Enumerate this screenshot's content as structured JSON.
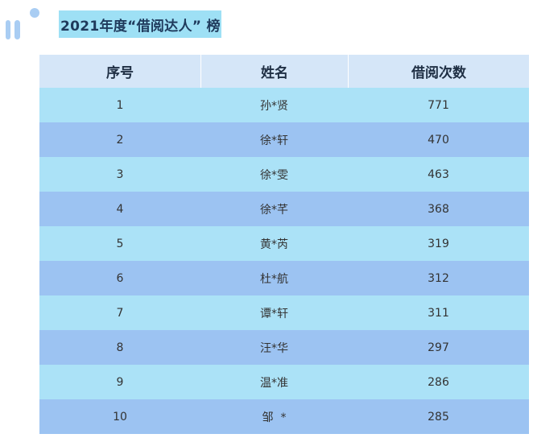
{
  "title": "2021年度“借阅达人” 榜",
  "colors": {
    "title_bg": "#9ee0f5",
    "header_bg": "#d5e6f8",
    "row_light": "#abe2f7",
    "row_dark": "#9cc3f2",
    "decoration": "#a9cdf3"
  },
  "table": {
    "headers": [
      "序号",
      "姓名",
      "借阅次数"
    ],
    "rows": [
      {
        "rank": "1",
        "name": "孙*贤",
        "count": "771"
      },
      {
        "rank": "2",
        "name": "徐*轩",
        "count": "470"
      },
      {
        "rank": "3",
        "name": "徐*雯",
        "count": "463"
      },
      {
        "rank": "4",
        "name": "徐*芊",
        "count": "368"
      },
      {
        "rank": "5",
        "name": "黄*芮",
        "count": "319"
      },
      {
        "rank": "6",
        "name": "杜*航",
        "count": "312"
      },
      {
        "rank": "7",
        "name": "谭*轩",
        "count": "311"
      },
      {
        "rank": "8",
        "name": "汪*华",
        "count": "297"
      },
      {
        "rank": "9",
        "name": "温*准",
        "count": "286"
      },
      {
        "rank": "10",
        "name": "邹  *",
        "count": "285"
      }
    ]
  }
}
